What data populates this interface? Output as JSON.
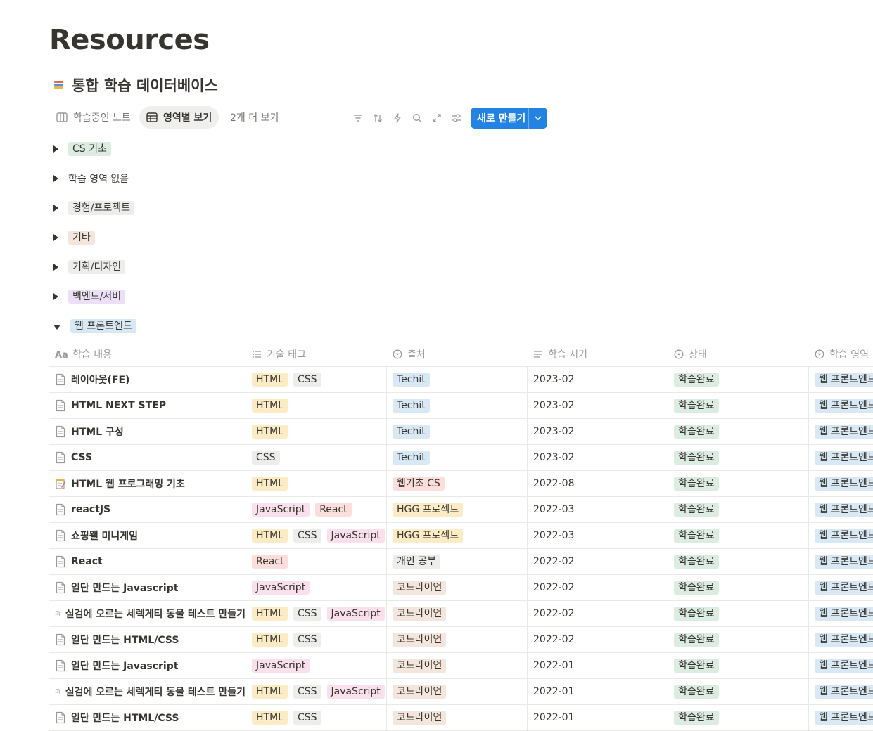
{
  "page": {
    "title": "Resources",
    "top_faint_text": ""
  },
  "database": {
    "title": "통합 학습 데이터베이스",
    "icon": "books-icon"
  },
  "views": {
    "tabs": [
      {
        "label": "학습중인 노트",
        "icon": "board-icon",
        "active": false
      },
      {
        "label": "영역별 보기",
        "icon": "table-icon",
        "active": true
      }
    ],
    "more_label": "2개 더 보기",
    "new_button_label": "새로 만들기"
  },
  "colors": {
    "accent": "#2383e2",
    "tag_yellow": "#fbecc6",
    "tag_gray": "#ededeb",
    "tag_pink": "#f9e0ec",
    "tag_red": "#fcdfdc",
    "tag_blue": "#d8e8f5",
    "tag_green": "#dcece3",
    "tag_brown": "#f4e6dc",
    "tag_purple": "#ebe0f5"
  },
  "groups": [
    {
      "label": "CS 기초",
      "color": "green",
      "expanded": false
    },
    {
      "label": "학습 영역 없음",
      "color": "none",
      "expanded": false
    },
    {
      "label": "경험/프로젝트",
      "color": "gray",
      "expanded": false
    },
    {
      "label": "기타",
      "color": "brown",
      "expanded": false
    },
    {
      "label": "기획/디자인",
      "color": "gray",
      "expanded": false
    },
    {
      "label": "백엔드/서버",
      "color": "purple",
      "expanded": false
    },
    {
      "label": "웹 프론트엔드",
      "color": "blue",
      "expanded": true
    }
  ],
  "table": {
    "columns": [
      {
        "label": "학습 내용",
        "icon": "title-aa-icon"
      },
      {
        "label": "기술 태그",
        "icon": "multi-select-icon"
      },
      {
        "label": "출처",
        "icon": "select-icon"
      },
      {
        "label": "학습 시기",
        "icon": "text-lines-icon"
      },
      {
        "label": "상태",
        "icon": "select-icon"
      },
      {
        "label": "학습 영역",
        "icon": "select-icon"
      }
    ],
    "rows": [
      {
        "name": "레이아웃(FE)",
        "icon": "page-icon",
        "tags": [
          "HTML",
          "CSS"
        ],
        "source": "Techit",
        "date": "2023-02",
        "status": "학습완료",
        "area": "웹 프론트엔드"
      },
      {
        "name": "HTML NEXT STEP",
        "icon": "page-icon",
        "tags": [
          "HTML"
        ],
        "source": "Techit",
        "date": "2023-02",
        "status": "학습완료",
        "area": "웹 프론트엔드"
      },
      {
        "name": "HTML 구성",
        "icon": "page-icon",
        "tags": [
          "HTML"
        ],
        "source": "Techit",
        "date": "2023-02",
        "status": "학습완료",
        "area": "웹 프론트엔드"
      },
      {
        "name": "CSS",
        "icon": "page-icon",
        "tags": [
          "CSS"
        ],
        "source": "Techit",
        "date": "2023-02",
        "status": "학습완료",
        "area": "웹 프론트엔드"
      },
      {
        "name": "HTML 웹 프로그래밍 기초",
        "icon": "memo-icon",
        "tags": [
          "HTML"
        ],
        "source": "웹기초 CS",
        "date": "2022-08",
        "status": "학습완료",
        "area": "웹 프론트엔드"
      },
      {
        "name": "reactJS",
        "icon": "page-icon",
        "tags": [
          "JavaScript",
          "React"
        ],
        "source": "HGG 프로젝트",
        "date": "2022-03",
        "status": "학습완료",
        "area": "웹 프론트엔드"
      },
      {
        "name": "쇼핑뫨 미니게임",
        "icon": "page-icon",
        "tags": [
          "HTML",
          "CSS",
          "JavaScript"
        ],
        "source": "HGG 프로젝트",
        "date": "2022-03",
        "status": "학습완료",
        "area": "웹 프론트엔드"
      },
      {
        "name": "React",
        "icon": "page-icon",
        "tags": [
          "React"
        ],
        "source": "개인 공부",
        "date": "2022-02",
        "status": "학습완료",
        "area": "웹 프론트엔드"
      },
      {
        "name": "일단 만드는 Javascript",
        "icon": "page-icon",
        "tags": [
          "JavaScript"
        ],
        "source": "코드라이언",
        "date": "2022-02",
        "status": "학습완료",
        "area": "웹 프론트엔드"
      },
      {
        "name": "실검에 오르는 세렉게티 동물 테스트 만들기",
        "icon": "page-icon",
        "tags": [
          "HTML",
          "CSS",
          "JavaScript"
        ],
        "source": "코드라이언",
        "date": "2022-02",
        "status": "학습완료",
        "area": "웹 프론트엔드"
      },
      {
        "name": "일단 만드는 HTML/CSS",
        "icon": "page-icon",
        "tags": [
          "HTML",
          "CSS"
        ],
        "source": "코드라이언",
        "date": "2022-02",
        "status": "학습완료",
        "area": "웹 프론트엔드"
      },
      {
        "name": "일단 만드는 Javascript",
        "icon": "page-icon",
        "tags": [
          "JavaScript"
        ],
        "source": "코드라이언",
        "date": "2022-01",
        "status": "학습완료",
        "area": "웹 프론트엔드"
      },
      {
        "name": "실검에 오르는 세렉게티 동물 테스트 만들기",
        "icon": "page-icon",
        "tags": [
          "HTML",
          "CSS",
          "JavaScript"
        ],
        "source": "코드라이언",
        "date": "2022-01",
        "status": "학습완료",
        "area": "웹 프론트엔드"
      },
      {
        "name": "일단 만드는 HTML/CSS",
        "icon": "page-icon",
        "tags": [
          "HTML",
          "CSS"
        ],
        "source": "코드라이언",
        "date": "2022-01",
        "status": "학습완료",
        "area": "웹 프론트엔드"
      }
    ]
  }
}
